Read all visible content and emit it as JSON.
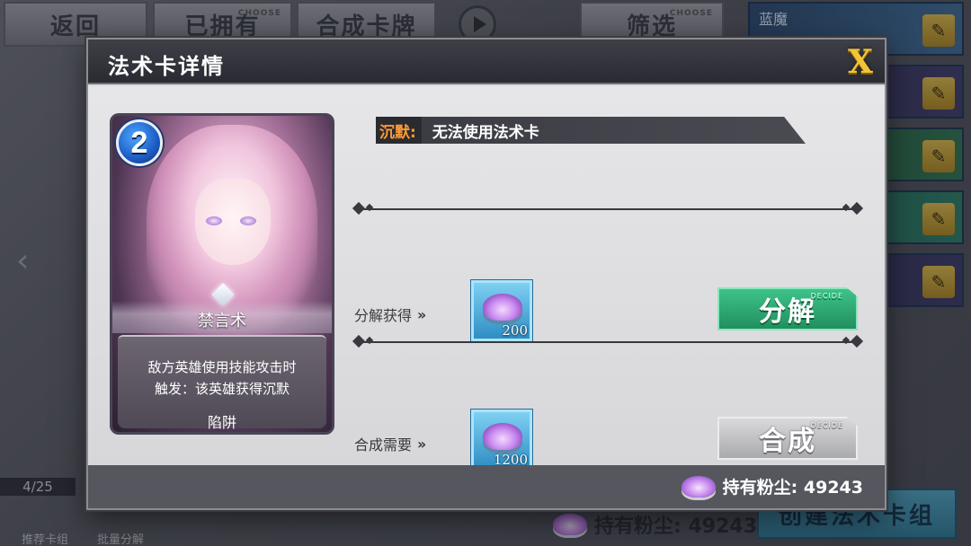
{
  "background": {
    "back_label": "返回",
    "owned_label": "已拥有",
    "compose_cards_label": "合成卡牌",
    "filter_label": "筛选",
    "choose_tag": "CHOOSE",
    "deck_names": [
      "蓝魔",
      "",
      "",
      "",
      ""
    ],
    "deck_count": "4/25",
    "recommend_label": "推荐卡组",
    "batch_decompose_label": "批量分解",
    "dust_label": "持有粉尘: 49243",
    "create_deck_label": "创建法术卡组"
  },
  "modal": {
    "title": "法术卡详情",
    "close_label": "X",
    "card": {
      "cost": "2",
      "name": "禁言术",
      "description_line1": "敌方英雄使用技能攻击时",
      "description_line2": "触发：该英雄获得沉默",
      "type": "陷阱"
    },
    "keyword": {
      "name": "沉默:",
      "description": "无法使用法术卡"
    },
    "decompose": {
      "label": "分解获得",
      "amount": "200",
      "button_label": "分解",
      "tag": "DECIDE"
    },
    "compose": {
      "label": "合成需要",
      "amount": "1200",
      "button_label": "合成",
      "tag": "DECIDE"
    },
    "footer": {
      "dust_label": "持有粉尘: 49243"
    }
  },
  "colors": {
    "keyword_accent": "#ff9a34",
    "decompose_button": "#2fae74",
    "compose_button": "#bdbdc1",
    "cost_badge": "#1c5cc4",
    "close_icon": "#f1c53a"
  },
  "icons": {
    "close": "close-icon",
    "dust": "dust-icon",
    "cost": "mana-cost-icon",
    "chevrons": "double-chevron-right-icon"
  }
}
